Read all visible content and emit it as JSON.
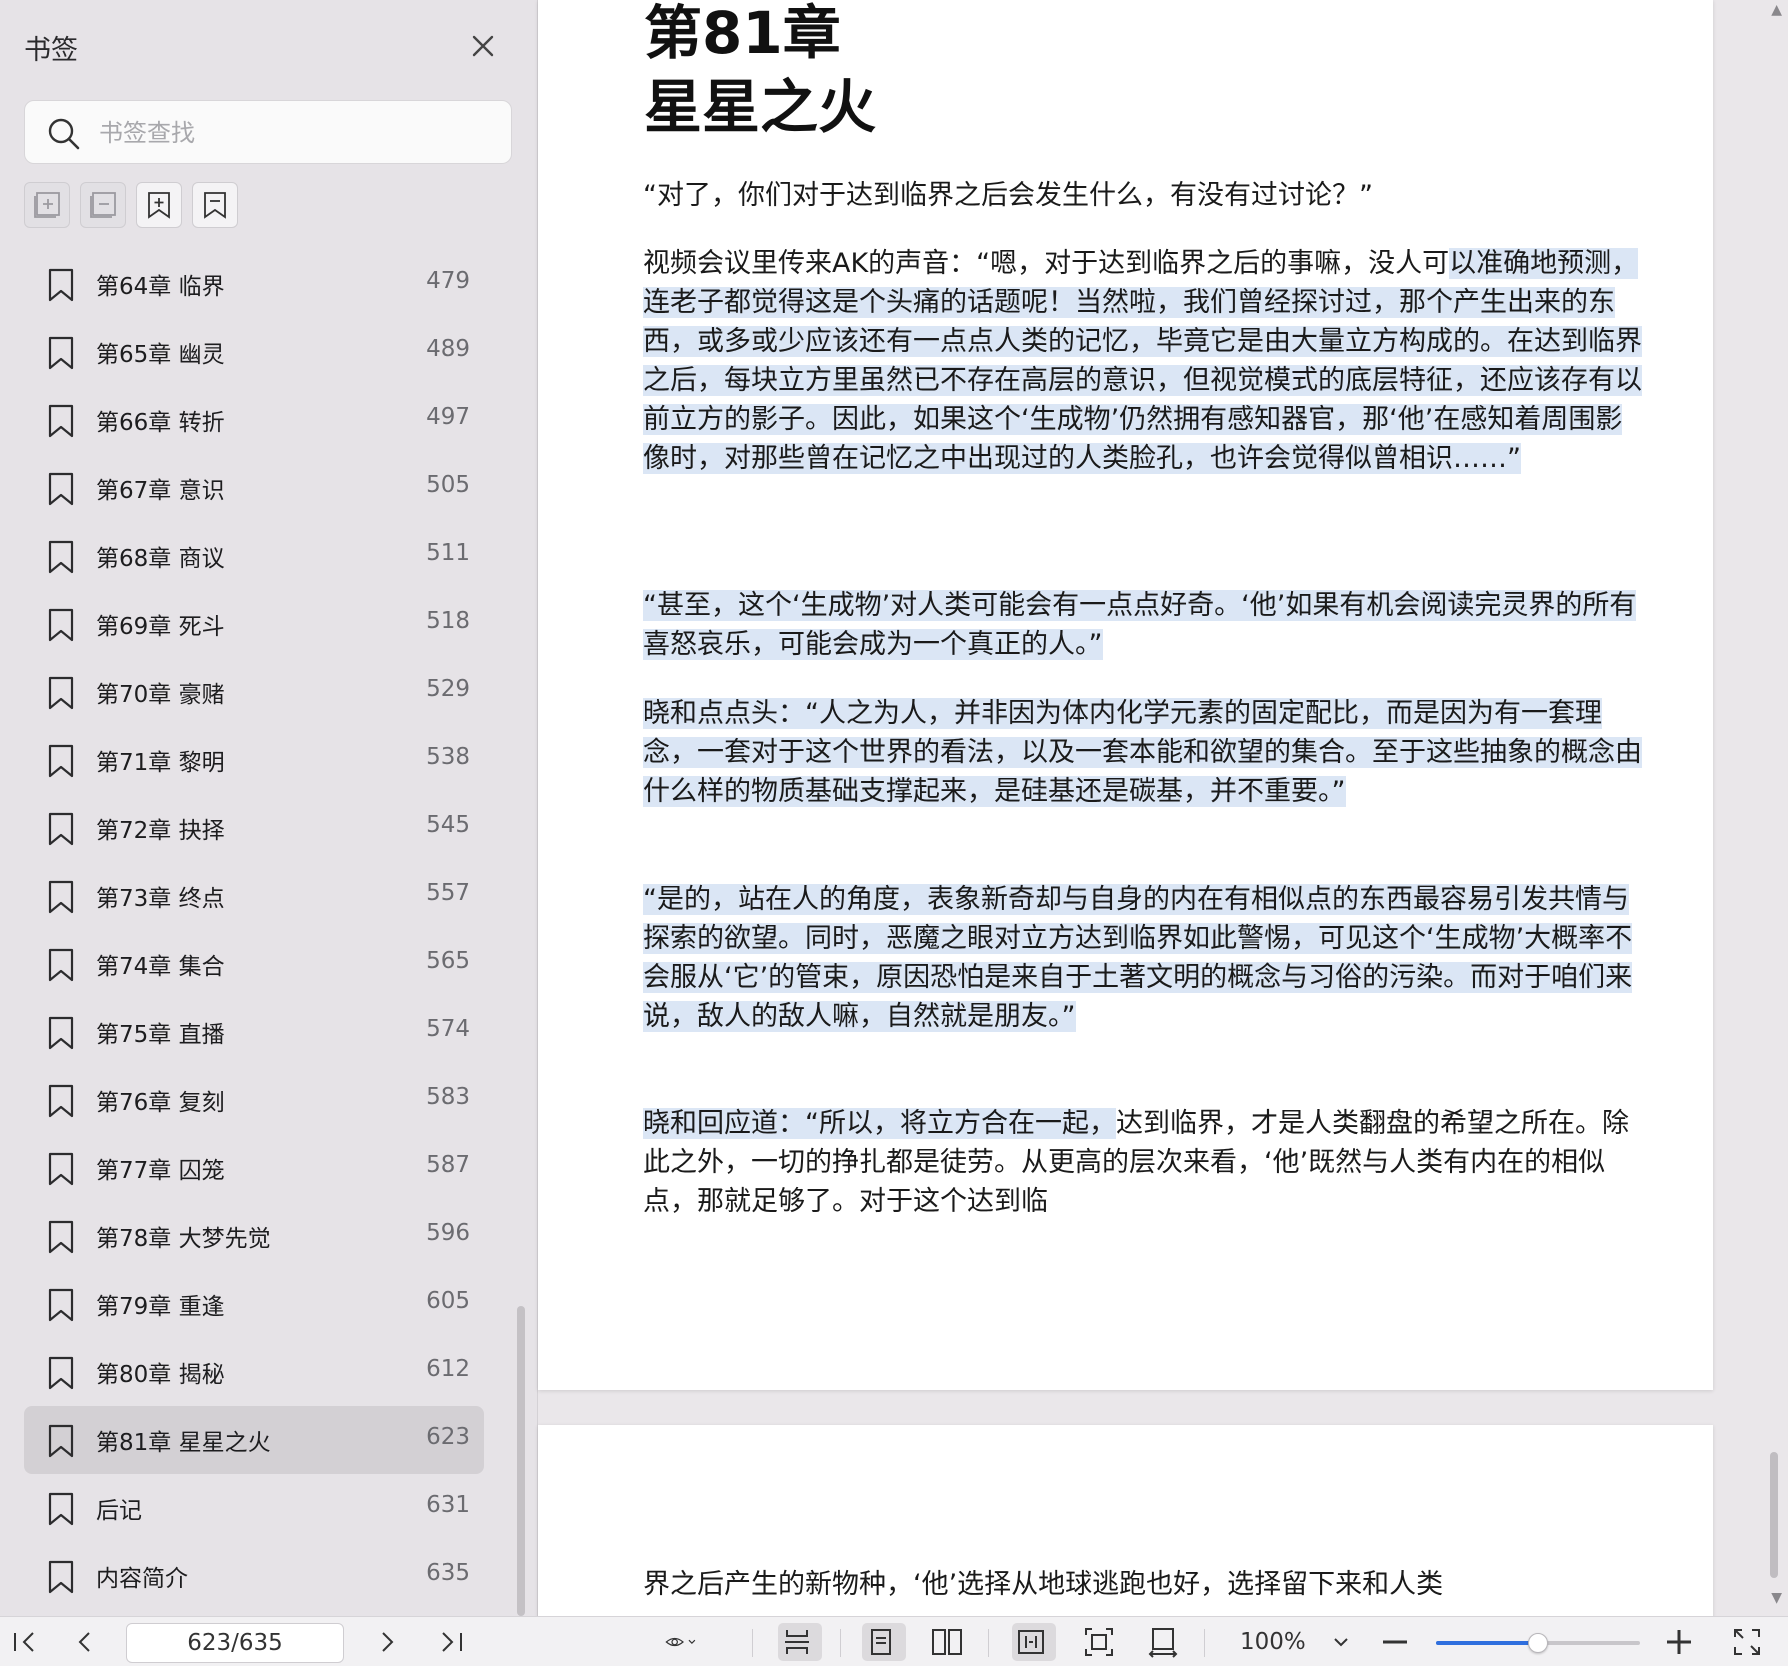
{
  "sidebar": {
    "title": "书签",
    "search_placeholder": "书签查找",
    "toolbar": {
      "tools": [
        {
          "icon": "expand-all-icon",
          "enabled": false
        },
        {
          "icon": "collapse-all-icon",
          "enabled": false
        },
        {
          "icon": "add-bookmark-icon",
          "enabled": true
        },
        {
          "icon": "bookmark-outline-icon",
          "enabled": true
        }
      ]
    },
    "bookmarks": [
      {
        "label": "第64章 临界",
        "page": "479"
      },
      {
        "label": "第65章 幽灵",
        "page": "489"
      },
      {
        "label": "第66章 转折",
        "page": "497"
      },
      {
        "label": "第67章 意识",
        "page": "505"
      },
      {
        "label": "第68章 商议",
        "page": "511"
      },
      {
        "label": "第69章 死斗",
        "page": "518"
      },
      {
        "label": "第70章 豪赌",
        "page": "529"
      },
      {
        "label": "第71章 黎明",
        "page": "538"
      },
      {
        "label": "第72章 抉择",
        "page": "545"
      },
      {
        "label": "第73章 终点",
        "page": "557"
      },
      {
        "label": "第74章 集合",
        "page": "565"
      },
      {
        "label": "第75章 直播",
        "page": "574"
      },
      {
        "label": "第76章 复刻",
        "page": "583"
      },
      {
        "label": "第77章 囚笼",
        "page": "587"
      },
      {
        "label": "第78章 大梦先觉",
        "page": "596"
      },
      {
        "label": "第79章 重逢",
        "page": "605"
      },
      {
        "label": "第80章 揭秘",
        "page": "612"
      },
      {
        "label": "第81章 星星之火",
        "page": "623",
        "selected": true
      },
      {
        "label": "后记",
        "page": "631"
      },
      {
        "label": "内容简介",
        "page": "635"
      }
    ]
  },
  "document": {
    "chapter_number": "第81章",
    "chapter_title": "星星之火",
    "p1": "“对了，你们对于达到临界之后会发生什么，有没有过讨论？”",
    "p2_plain": "视频会议里传来AK的声音：“嗯，对于达到临界之后的事嘛，没人可",
    "p2_highlight": "以准确地预测，连老子都觉得这是个头痛的话题呢！当然啦，我们曾经探讨过，那个产生出来的东西，或多或少应该还有一点点人类的记忆，毕竟它是由大量立方构成的。在达到临界之后，每块立方里虽然已不存在高层的意识，但视觉模式的底层特征，还应该存有以前立方的影子。因此，如果这个‘生成物’仍然拥有感知器官，那‘他’在感知着周围影像时，对那些曾在记忆之中出现过的人类脸孔，也许会觉得似曾相识……”",
    "p3": "“甚至，这个‘生成物’对人类可能会有一点点好奇。‘他’如果有机会阅读完灵界的所有喜怒哀乐，可能会成为一个真正的人。”",
    "p4": "晓和点点头：“人之为人，并非因为体内化学元素的固定配比，而是因为有一套理念，一套对于这个世界的看法，以及一套本能和欲望的集合。至于这些抽象的概念由什么样的物质基础支撑起来，是硅基还是碳基，并不重要。”",
    "p5": "“是的，站在人的角度，表象新奇却与自身的内在有相似点的东西最容易引发共情与探索的欲望。同时，恶魔之眼对立方达到临界如此警惕，可见这个‘生成物’大概率不会服从‘它’的管束，原因恐怕是来自于土著文明的概念与习俗的污染。而对于咱们来说，敌人的敌人嘛，自然就是朋友。”",
    "p6_highlight": "晓和回应道：“所以，将立方合在一起，",
    "p6_plain": "达到临界，才是人类翻盘的希望之所在。除此之外，一切的挣扎都是徒劳。从更高的层次来看，‘他’既然与人类有内在的相似点，那就足够了。对于这个达到临",
    "page2_text": "界之后产生的新物种，‘他’选择从地球逃跑也好，选择留下来和人类"
  },
  "bottombar": {
    "page_indicator": "623/635",
    "zoom": "100%",
    "zoom_slider_value": 0.5
  },
  "colors": {
    "highlight": "#dbe6f5",
    "slider_accent": "#2f6fde",
    "sidebar_bg": "#e6e3e7"
  }
}
